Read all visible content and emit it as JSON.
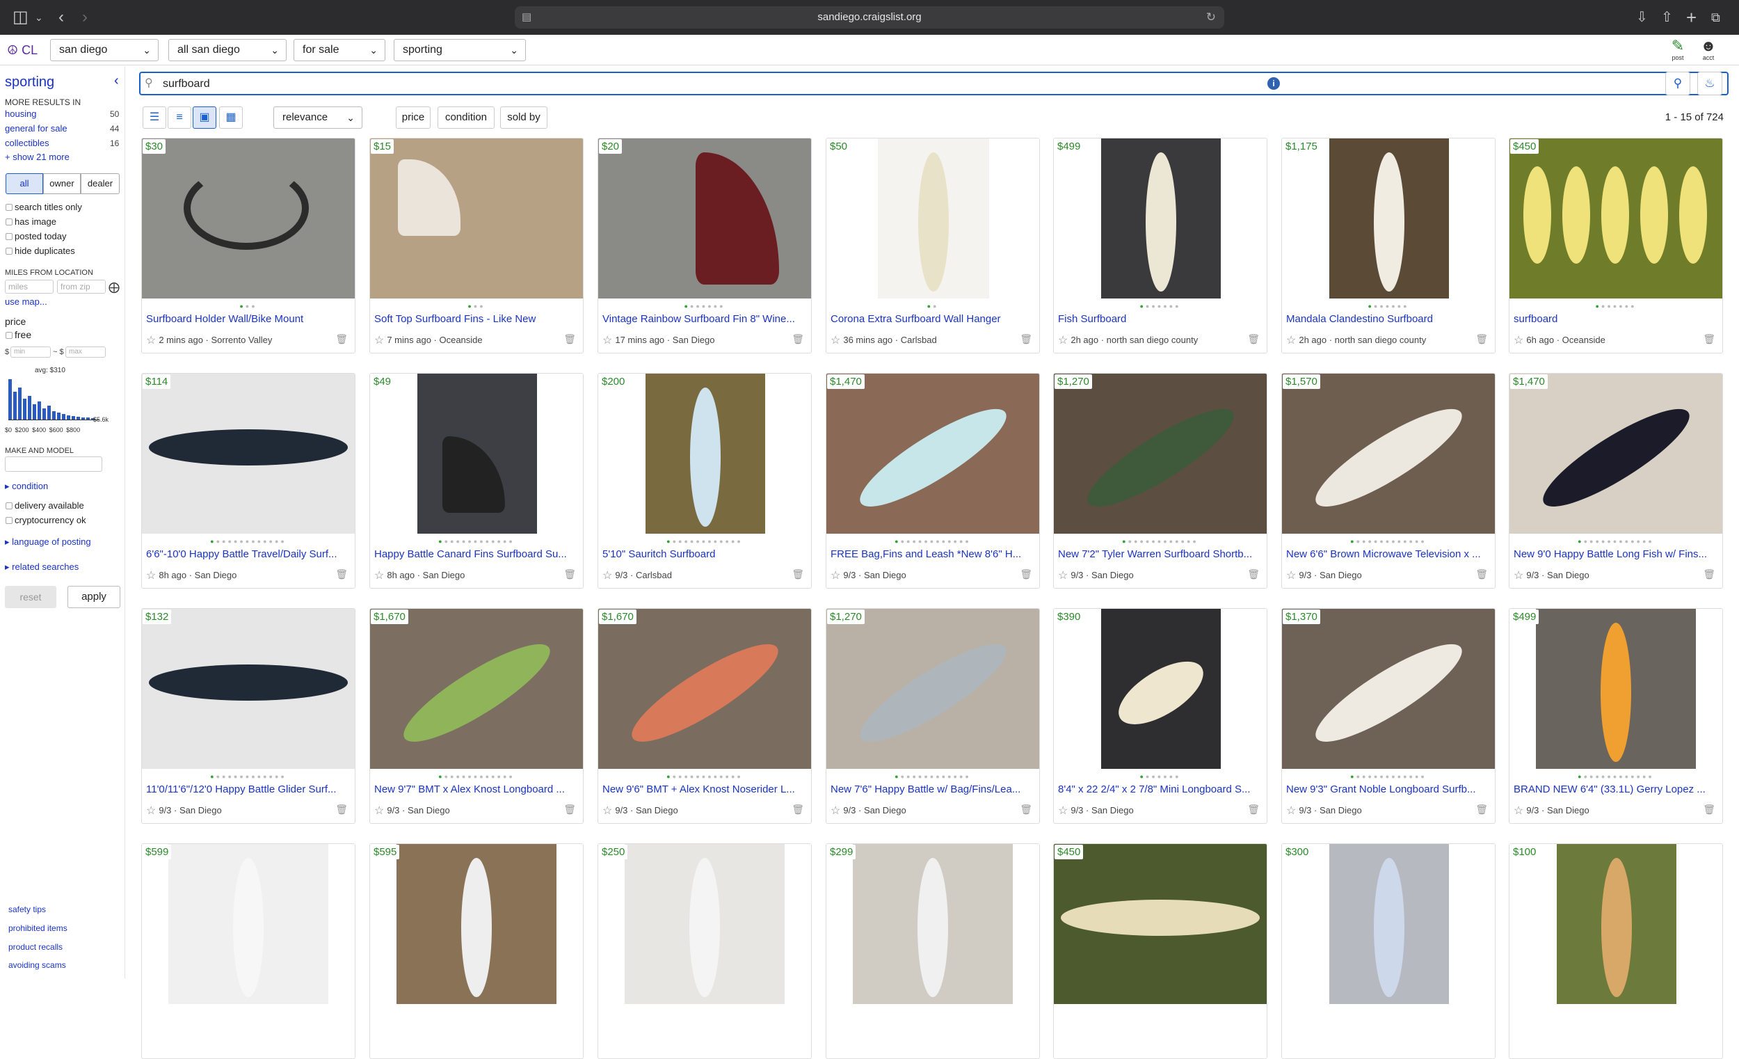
{
  "browser": {
    "url": "sandiego.craigslist.org"
  },
  "header": {
    "logo": "CL",
    "selects": [
      "san diego",
      "all san diego",
      "for sale",
      "sporting"
    ],
    "post_label": "post",
    "acct_label": "acct"
  },
  "sidebar": {
    "category": "sporting",
    "more_results_label": "MORE RESULTS IN",
    "more_results": [
      {
        "label": "housing",
        "count": "50"
      },
      {
        "label": "general for sale",
        "count": "44"
      },
      {
        "label": "collectibles",
        "count": "16"
      }
    ],
    "show_more": "+ show 21 more",
    "seller_toggle": [
      "all",
      "owner",
      "dealer"
    ],
    "checkboxes": [
      "search titles only",
      "has image",
      "posted today",
      "hide duplicates"
    ],
    "miles_label": "MILES FROM LOCATION",
    "miles_placeholder": "miles",
    "zip_placeholder": "from zip",
    "use_map": "use map...",
    "price_label": "price",
    "free_label": "free",
    "min_prefix": "$",
    "min_placeholder": "min",
    "max_prefix": "~ $",
    "max_placeholder": "max",
    "avg_label": "avg: $310",
    "hist_ticks": [
      "$0",
      "$200",
      "$400",
      "$600",
      "$800"
    ],
    "hist_max": "$5.6k",
    "make_model_label": "MAKE AND MODEL",
    "condition_label": "condition",
    "checkboxes2": [
      "delivery available",
      "cryptocurrency ok"
    ],
    "language_label": "language of posting",
    "related_label": "related searches",
    "reset_label": "reset",
    "apply_label": "apply",
    "footer_links": [
      "safety tips",
      "prohibited items",
      "product recalls",
      "avoiding scams"
    ]
  },
  "search": {
    "query": "surfboard"
  },
  "toolbar": {
    "sort": "relevance",
    "filters": [
      "price",
      "condition",
      "sold by"
    ],
    "count": "1 - 15 of 724"
  },
  "listings": [
    {
      "price": "$30",
      "title": "Surfboard Holder Wall/Bike Mount",
      "meta": "2 mins ago · Sorrento Valley"
    },
    {
      "price": "$15",
      "title": "Soft Top Surfboard Fins - Like New",
      "meta": "7 mins ago · Oceanside"
    },
    {
      "price": "$20",
      "title": "Vintage Rainbow Surfboard Fin 8\" Wine...",
      "meta": "17 mins ago · San Diego"
    },
    {
      "price": "$50",
      "title": "Corona Extra Surfboard Wall Hanger",
      "meta": "36 mins ago · Carlsbad"
    },
    {
      "price": "$499",
      "title": "Fish Surfboard",
      "meta": "2h ago · north san diego county"
    },
    {
      "price": "$1,175",
      "title": "Mandala Clandestino Surfboard",
      "meta": "2h ago · north san diego county"
    },
    {
      "price": "$450",
      "title": "surfboard",
      "meta": "6h ago · Oceanside"
    },
    {
      "price": "$114",
      "title": "6'6\"-10'0 Happy Battle Travel/Daily Surf...",
      "meta": "8h ago · San Diego"
    },
    {
      "price": "$49",
      "title": "Happy Battle Canard Fins Surfboard Su...",
      "meta": "8h ago · San Diego"
    },
    {
      "price": "$200",
      "title": "5'10\" Sauritch Surfboard",
      "meta": "9/3 · Carlsbad"
    },
    {
      "price": "$1,470",
      "title": "FREE Bag,Fins and Leash *New 8'6\" H...",
      "meta": "9/3 · San Diego"
    },
    {
      "price": "$1,270",
      "title": "New 7'2\" Tyler Warren Surfboard Shortb...",
      "meta": "9/3 · San Diego"
    },
    {
      "price": "$1,570",
      "title": "New 6'6\" Brown Microwave Television x ...",
      "meta": "9/3 · San Diego"
    },
    {
      "price": "$1,470",
      "title": "New 9'0 Happy Battle Long Fish w/ Fins...",
      "meta": "9/3 · San Diego"
    },
    {
      "price": "$132",
      "title": "11'0/11'6\"/12'0 Happy Battle Glider Surf...",
      "meta": "9/3 · San Diego"
    },
    {
      "price": "$1,670",
      "title": "New 9'7\" BMT x Alex Knost Longboard ...",
      "meta": "9/3 · San Diego"
    },
    {
      "price": "$1,670",
      "title": "New 9'6\" BMT + Alex Knost Noserider L...",
      "meta": "9/3 · San Diego"
    },
    {
      "price": "$1,270",
      "title": "New 7'6\" Happy Battle w/ Bag/Fins/Lea...",
      "meta": "9/3 · San Diego"
    },
    {
      "price": "$390",
      "title": "8'4\" x 22 2/4\" x 2 7/8\" Mini Longboard S...",
      "meta": "9/3 · San Diego"
    },
    {
      "price": "$1,370",
      "title": "New 9'3\" Grant Noble Longboard Surfb...",
      "meta": "9/3 · San Diego"
    },
    {
      "price": "$499",
      "title": "BRAND NEW 6'4\" (33.1L) Gerry Lopez ...",
      "meta": "9/3 · San Diego"
    },
    {
      "price": "$599",
      "title": "",
      "meta": ""
    },
    {
      "price": "$595",
      "title": "",
      "meta": ""
    },
    {
      "price": "$250",
      "title": "",
      "meta": ""
    },
    {
      "price": "$299",
      "title": "",
      "meta": ""
    },
    {
      "price": "$450",
      "title": "",
      "meta": ""
    },
    {
      "price": "$300",
      "title": "",
      "meta": ""
    },
    {
      "price": "$100",
      "title": "",
      "meta": ""
    }
  ]
}
